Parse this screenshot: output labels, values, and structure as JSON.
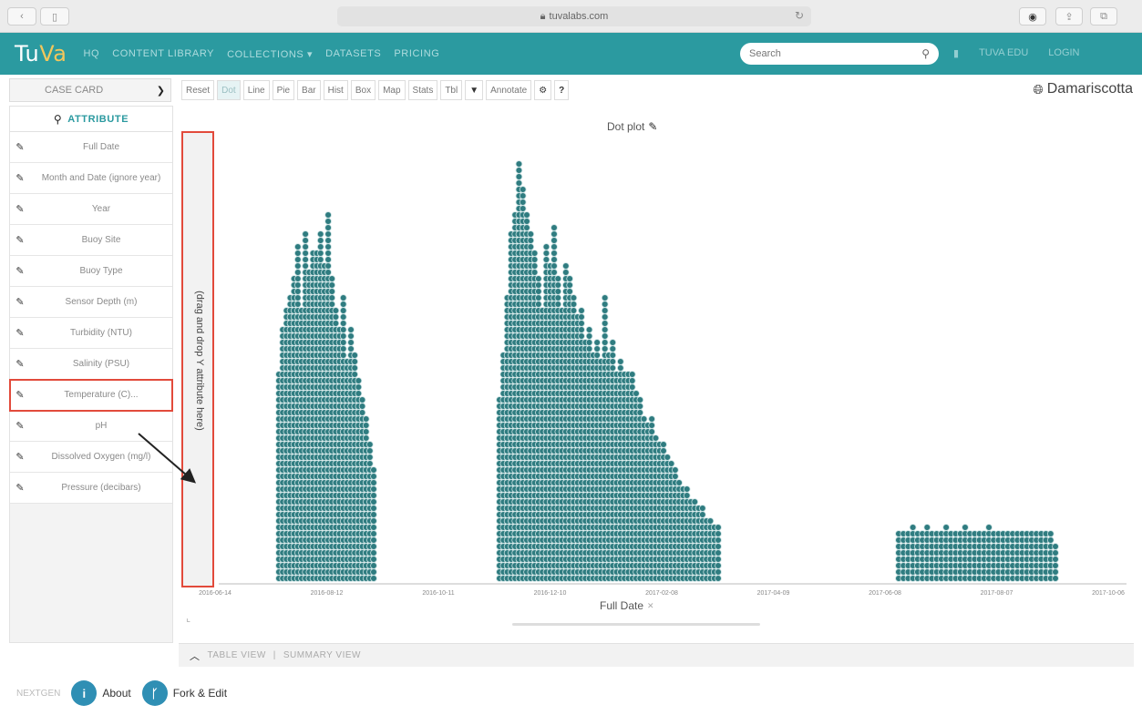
{
  "browser": {
    "url": "tuvalabs.com",
    "tab_icon": "sidebar-icon"
  },
  "navbar": {
    "logo_main": "Tu",
    "logo_accent": "Va",
    "items": [
      "HQ",
      "CONTENT LIBRARY",
      "COLLECTIONS ▾",
      "DATASETS",
      "PRICING"
    ],
    "search_placeholder": "Search",
    "right_items": [
      "▮",
      "TUVA EDU",
      "LOGIN"
    ]
  },
  "toolbar": {
    "case_card_label": "CASE CARD",
    "tools": [
      "Reset",
      "Dot",
      "Line",
      "Pie",
      "Bar",
      "Hist",
      "Box",
      "Map",
      "Stats",
      "Tbl",
      "▼",
      "Annotate",
      "⚙",
      "?"
    ],
    "active_tool": "Dot",
    "location": "Damariscotta"
  },
  "sidebar": {
    "header": "ATTRIBUTE",
    "attributes": [
      {
        "label": "Full Date",
        "highlight": false
      },
      {
        "label": "Month and Date (ignore year)",
        "highlight": false
      },
      {
        "label": "Year",
        "highlight": false
      },
      {
        "label": "Buoy Site",
        "highlight": false
      },
      {
        "label": "Buoy Type",
        "highlight": false
      },
      {
        "label": "Sensor Depth (m)",
        "highlight": false
      },
      {
        "label": "Turbidity (NTU)",
        "highlight": false
      },
      {
        "label": "Salinity (PSU)",
        "highlight": false
      },
      {
        "label": "Temperature (C)...",
        "highlight": true
      },
      {
        "label": "pH",
        "highlight": false
      },
      {
        "label": "Dissolved Oxygen (mg/l)",
        "highlight": false
      },
      {
        "label": "Pressure (decibars)",
        "highlight": false
      }
    ]
  },
  "graph": {
    "title": "Dot plot",
    "y_drop_text": "(drag and drop Y attribute here)",
    "x_attribute": "Full Date",
    "x_ticks": [
      "2016-06-14",
      "2016-08-12",
      "2016-10-11",
      "2016-12-10",
      "2017-02-08",
      "2017-04-09",
      "2017-06-08",
      "2017-08-07",
      "2017-10-06"
    ],
    "dot_color": "#2f7c80",
    "highlight_color": "#e24a3b"
  },
  "bottom": {
    "table_view": "TABLE VIEW",
    "summary_view": "SUMMARY VIEW"
  },
  "footer": {
    "faint_label": "NEXTGEN",
    "about": "About",
    "fork": "Fork & Edit"
  }
}
